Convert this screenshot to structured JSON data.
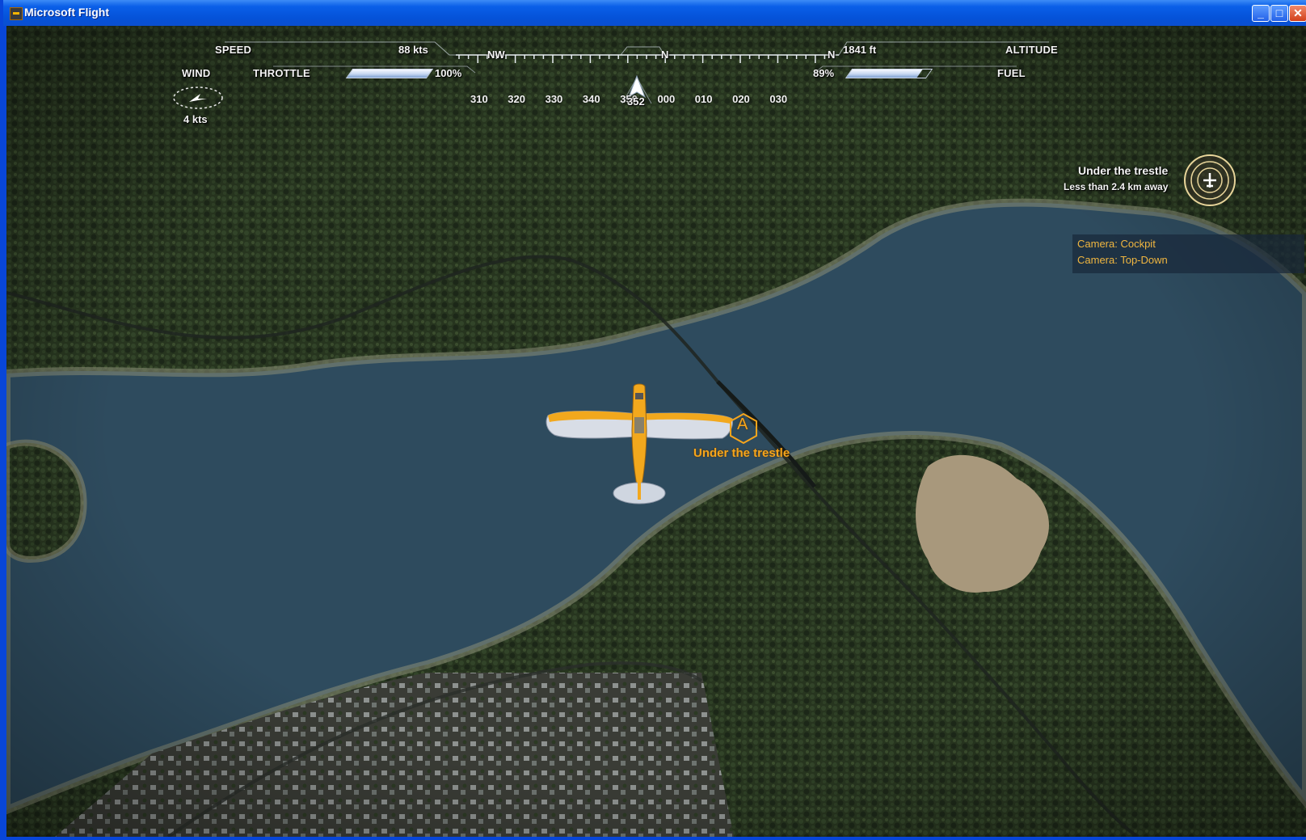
{
  "window": {
    "title": "Microsoft Flight",
    "controls": {
      "minimize": "_",
      "maximize": "□",
      "close": "✕"
    }
  },
  "hud": {
    "speed_label": "SPEED",
    "speed_value": "88 kts",
    "throttle_label": "THROTTLE",
    "throttle_value": "100%",
    "throttle_fraction": 1.0,
    "wind_label": "WIND",
    "wind_value": "4  kts",
    "altitude_label": "ALTITUDE",
    "altitude_value": "1841 ft",
    "fuel_label": "FUEL",
    "fuel_value": "89%",
    "fuel_fraction": 0.89,
    "heading_value": "352",
    "compass": {
      "cardinals": [
        {
          "label": "NW"
        },
        {
          "label": "N"
        },
        {
          "label": "N"
        }
      ],
      "ticks": [
        "310",
        "320",
        "330",
        "340",
        "350",
        "000",
        "010",
        "020",
        "030"
      ]
    }
  },
  "objective": {
    "title": "Under the trestle",
    "distance": "Less than 2.4 km away"
  },
  "waypoint": {
    "marker_letter": "A",
    "label": "Under the trestle"
  },
  "camera_menu": {
    "items": [
      "Camera: Cockpit",
      "Camera: Top-Down"
    ]
  },
  "colors": {
    "hud_text": "#f4f4f4",
    "mission_orange": "#f6a51c",
    "camera_text": "#f0b640",
    "water": "#2d4a5e",
    "forest": "#24301f",
    "titlebar_blue": "#0552d8"
  }
}
